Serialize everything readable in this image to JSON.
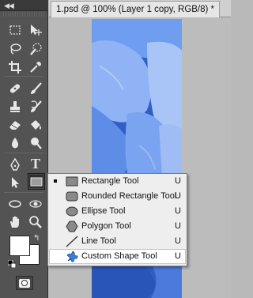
{
  "toolbar": {
    "collapse_glyph": "◀◀",
    "tools": [
      {
        "name": "rectangular-marquee-icon"
      },
      {
        "name": "move-icon"
      },
      {
        "name": "lasso-icon"
      },
      {
        "name": "quick-selection-icon"
      },
      {
        "name": "crop-icon"
      },
      {
        "name": "eyedropper-icon"
      },
      {
        "name": "spot-healing-brush-icon"
      },
      {
        "name": "brush-icon"
      },
      {
        "name": "clone-stamp-icon"
      },
      {
        "name": "history-brush-icon"
      },
      {
        "name": "eraser-icon"
      },
      {
        "name": "paint-bucket-icon"
      },
      {
        "name": "blur-icon"
      },
      {
        "name": "dodge-icon"
      },
      {
        "name": "pen-icon"
      },
      {
        "name": "type-icon",
        "glyph": "T"
      },
      {
        "name": "path-selection-icon"
      },
      {
        "name": "rectangle-tool-icon",
        "active": true
      },
      {
        "name": "3d-rotate-icon"
      },
      {
        "name": "3d-orbit-icon"
      },
      {
        "name": "hand-icon"
      },
      {
        "name": "zoom-icon"
      }
    ],
    "foreground_color": "#ffffff",
    "background_color": "#ffffff"
  },
  "document": {
    "tab_title": "1.psd @ 100% (Layer 1 copy, RGB/8) *"
  },
  "flyout": {
    "items": [
      {
        "icon": "rectangle-shape-icon",
        "label": "Rectangle Tool",
        "key": "U",
        "current": true
      },
      {
        "icon": "rounded-rectangle-shape-icon",
        "label": "Rounded Rectangle Tool",
        "key": "U",
        "current": false
      },
      {
        "icon": "ellipse-shape-icon",
        "label": "Ellipse Tool",
        "key": "U",
        "current": false
      },
      {
        "icon": "polygon-shape-icon",
        "label": "Polygon Tool",
        "key": "U",
        "current": false
      },
      {
        "icon": "line-shape-icon",
        "label": "Line Tool",
        "key": "U",
        "current": false
      },
      {
        "icon": "custom-shape-icon",
        "label": "Custom Shape Tool",
        "key": "U",
        "current": false,
        "hovered": true
      }
    ]
  },
  "colors": {
    "panel": "#535353",
    "menu_bg": "#eeeeee",
    "photo_blue": "#3f70cf"
  }
}
